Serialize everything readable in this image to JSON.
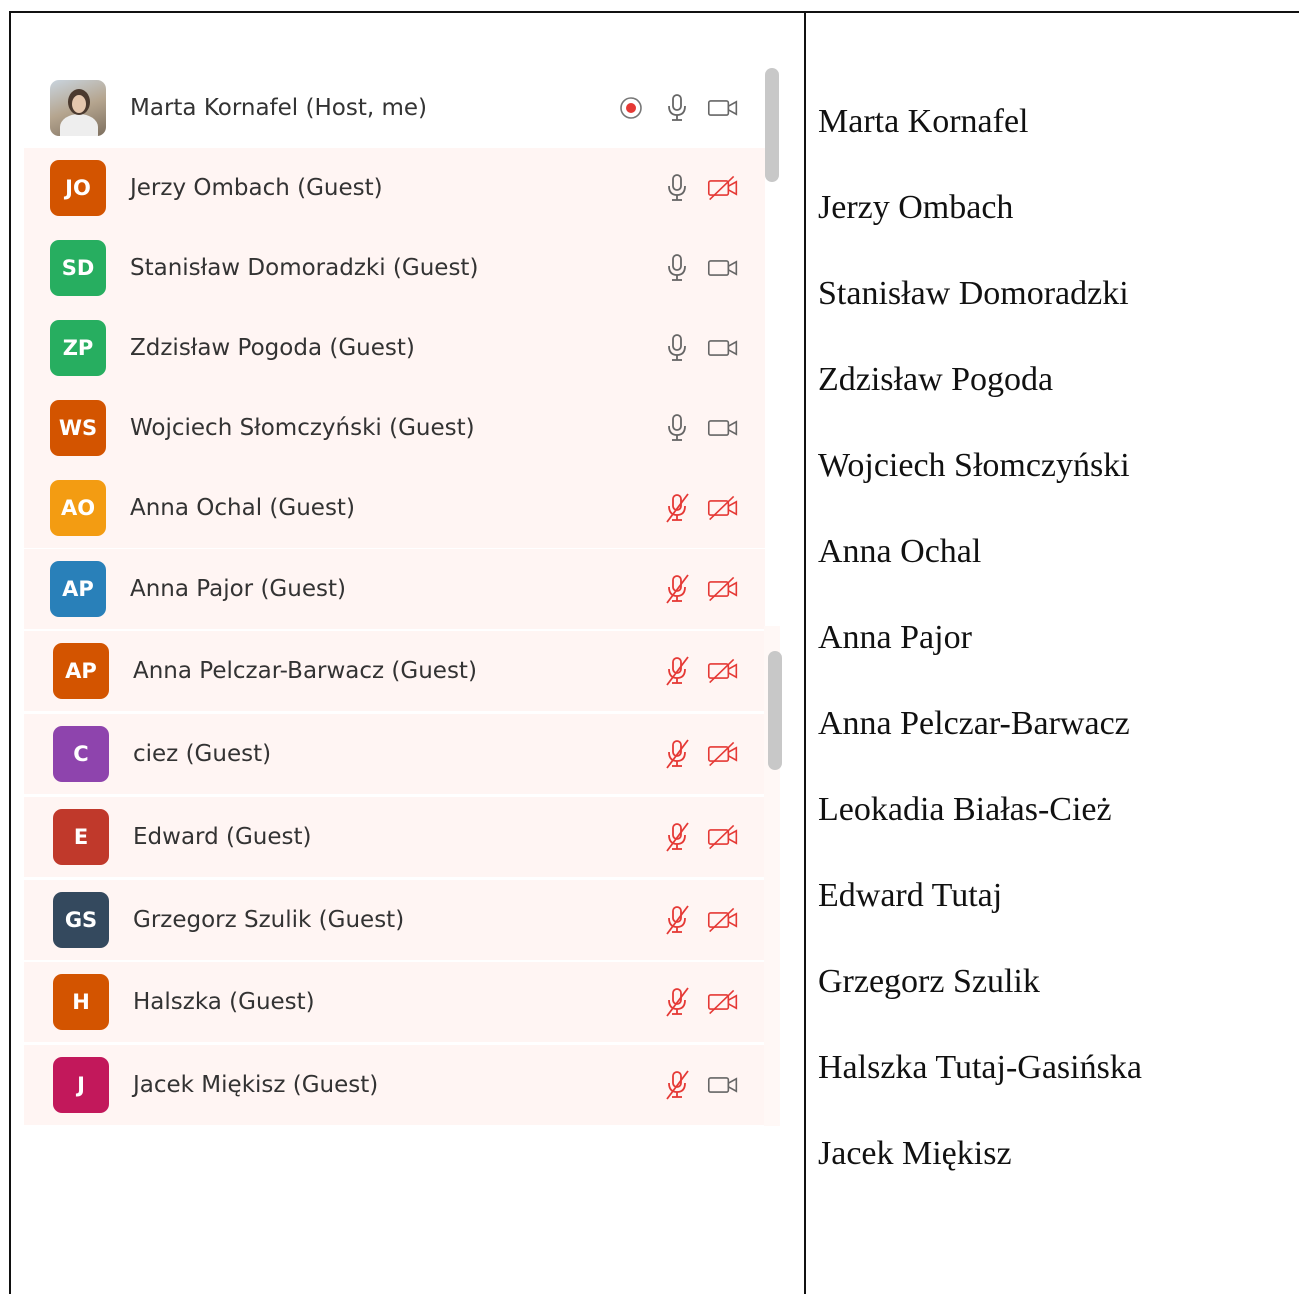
{
  "participants": [
    {
      "initials": "",
      "name": "Marta Kornafel (Host, me)",
      "color": "#9aa9b8",
      "photo": true,
      "recording": true,
      "mic_muted": false,
      "video_off": false
    },
    {
      "initials": "JO",
      "name": "Jerzy Ombach (Guest)",
      "color": "#d35400",
      "mic_muted": false,
      "video_off": true
    },
    {
      "initials": "SD",
      "name": "Stanisław Domoradzki (Guest)",
      "color": "#27ae60",
      "mic_muted": false,
      "video_off": false
    },
    {
      "initials": "ZP",
      "name": "Zdzisław Pogoda (Guest)",
      "color": "#27ae60",
      "mic_muted": false,
      "video_off": false
    },
    {
      "initials": "WS",
      "name": "Wojciech Słomczyński (Guest)",
      "color": "#d35400",
      "mic_muted": false,
      "video_off": false
    },
    {
      "initials": "AO",
      "name": "Anna Ochal (Guest)",
      "color": "#f39c12",
      "mic_muted": true,
      "video_off": true
    },
    {
      "initials": "AP",
      "name": "Anna Pajor (Guest)",
      "color": "#2980b9",
      "mic_muted": true,
      "video_off": true
    },
    {
      "initials": "AP",
      "name": "Anna Pelczar-Barwacz (Guest)",
      "color": "#d35400",
      "mic_muted": true,
      "video_off": true
    },
    {
      "initials": "C",
      "name": "ciez (Guest)",
      "color": "#8e44ad",
      "mic_muted": true,
      "video_off": true
    },
    {
      "initials": "E",
      "name": "Edward (Guest)",
      "color": "#c0392b",
      "mic_muted": true,
      "video_off": true
    },
    {
      "initials": "GS",
      "name": "Grzegorz Szulik (Guest)",
      "color": "#34495e",
      "mic_muted": true,
      "video_off": true
    },
    {
      "initials": "H",
      "name": "Halszka (Guest)",
      "color": "#d35400",
      "mic_muted": true,
      "video_off": true
    },
    {
      "initials": "J",
      "name": "Jacek Miękisz (Guest)",
      "color": "#c2185b",
      "mic_muted": true,
      "video_off": false
    }
  ],
  "full_names": [
    "Marta Kornafel",
    "Jerzy Ombach",
    "Stanisław Domoradzki",
    "Zdzisław Pogoda",
    "Wojciech Słomczyński",
    "Anna Ochal",
    "Anna Pajor",
    "Anna Pelczar-Barwacz",
    "Leokadia Białas-Cież",
    "Edward Tutaj",
    "Grzegorz Szulik",
    "Halszka Tutaj-Gasińska",
    "Jacek Miękisz"
  ],
  "colors": {
    "muted_icon": "#e53935",
    "active_icon": "#666666",
    "record_dot": "#e53935"
  }
}
